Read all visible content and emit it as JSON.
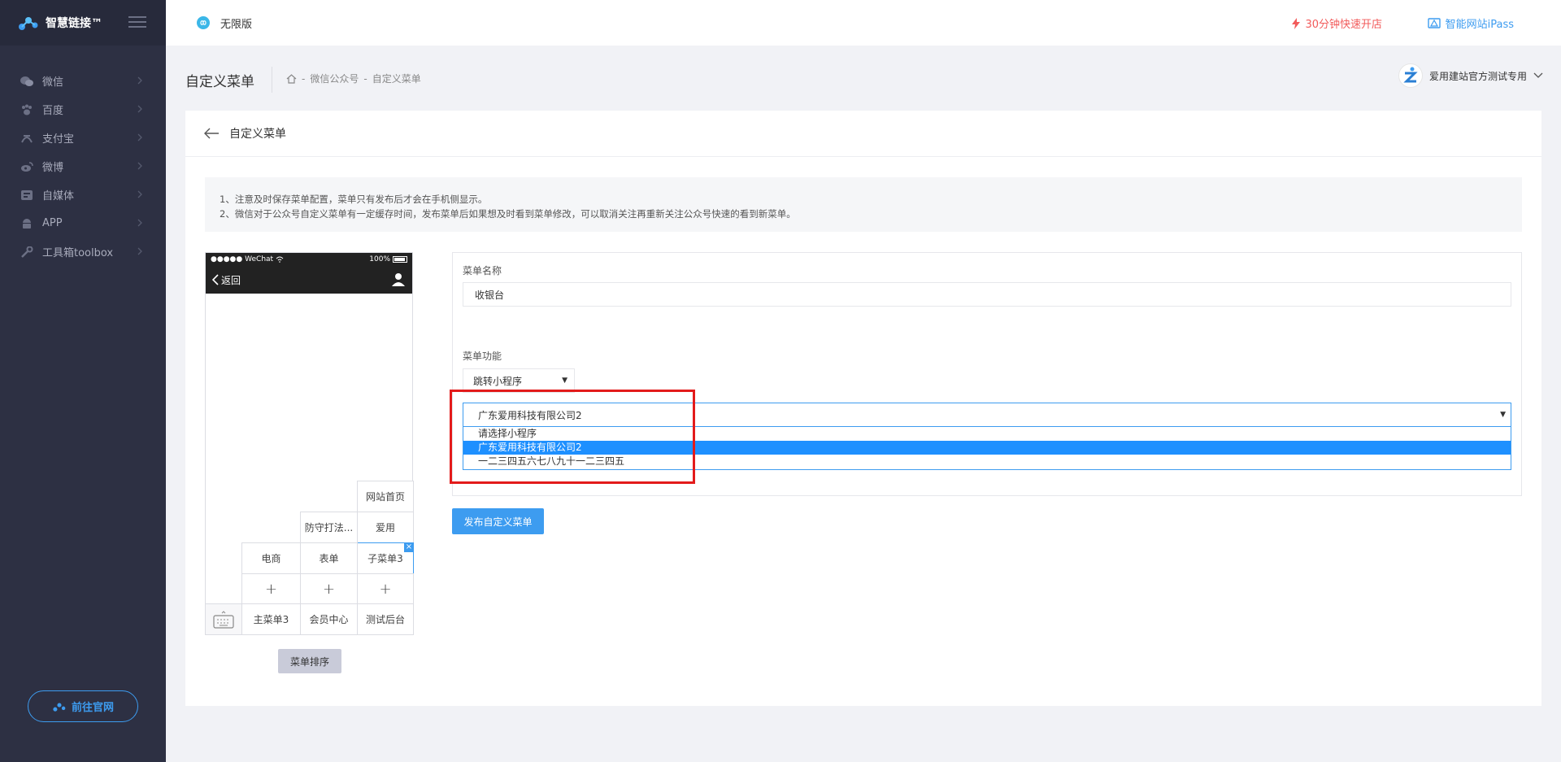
{
  "brand": {
    "name": "智慧链接™"
  },
  "sidebar": {
    "items": [
      {
        "label": "微信",
        "icon": "wechat-icon"
      },
      {
        "label": "百度",
        "icon": "paw-icon"
      },
      {
        "label": "支付宝",
        "icon": "alipay-icon"
      },
      {
        "label": "微博",
        "icon": "weibo-icon"
      },
      {
        "label": "自媒体",
        "icon": "media-icon"
      },
      {
        "label": "APP",
        "icon": "android-icon"
      },
      {
        "label": "工具箱toolbox",
        "icon": "wrench-icon"
      }
    ],
    "visit_button": "前往官网"
  },
  "topbar": {
    "edition": "无限版",
    "quick_open": "30分钟快速开店",
    "ipass": "智能网站iPass"
  },
  "page": {
    "title": "自定义菜单",
    "breadcrumb": [
      "微信公众号",
      "自定义菜单"
    ],
    "account": "爱用建站官方测试专用"
  },
  "card": {
    "title": "自定义菜单",
    "notices": [
      "1、注意及时保存菜单配置，菜单只有发布后才会在手机侧显示。",
      "2、微信对于公众号自定义菜单有一定缓存时间，发布菜单后如果想及时看到菜单修改，可以取消关注再重新关注公众号快速的看到新菜单。"
    ]
  },
  "phone": {
    "carrier": "●●●●● WeChat",
    "battery": "100%",
    "back": "返回",
    "sub_cells": {
      "c3": [
        "网站首页",
        "爱用",
        "子菜单3"
      ],
      "c2": [
        "防守打法...",
        "表单"
      ],
      "c1": [
        "电商"
      ]
    },
    "main_menu": [
      "主菜单3",
      "会员中心",
      "测试后台"
    ],
    "plus": "+",
    "close": "×",
    "sort_button": "菜单排序"
  },
  "form": {
    "name_label": "菜单名称",
    "name_value": "收银台",
    "func_label": "菜单功能",
    "func_value": "跳转小程序",
    "mini_selected": "广东爱用科技有限公司2",
    "mini_options": [
      "请选择小程序",
      "广东爱用科技有限公司2",
      "一二三四五六七八九十一二三四五"
    ],
    "publish_button": "发布自定义菜单"
  },
  "colors": {
    "sidebar": "#2d3043",
    "accent": "#3d9cf0",
    "alert": "#f25b5b",
    "highlight": "#e31b1b"
  }
}
